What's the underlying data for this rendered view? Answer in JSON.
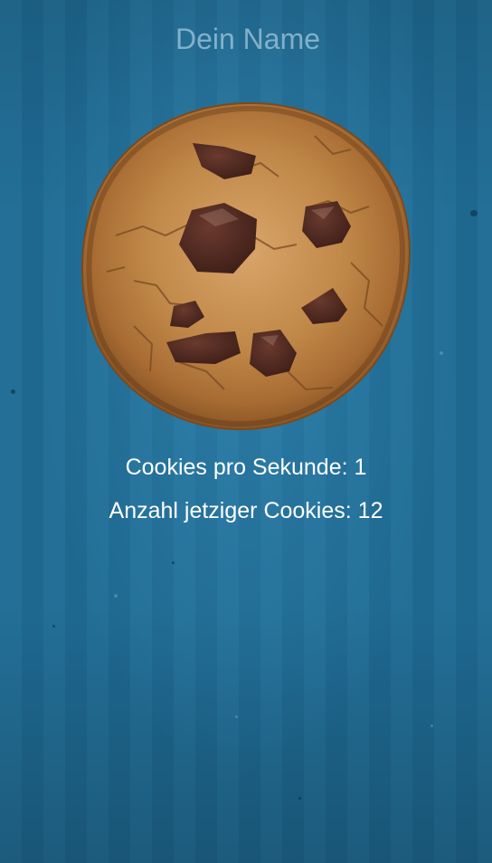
{
  "header": {
    "name_placeholder": "Dein Name",
    "name_value": ""
  },
  "cookie": {
    "icon": "cookie-icon"
  },
  "stats": {
    "cps_label": "Cookies pro Sekunde:",
    "cps_value": "1",
    "count_label": "Anzahl jetziger Cookies:",
    "count_value": "12"
  },
  "colors": {
    "background": "#1f6f96",
    "text": "#ffffff",
    "cookie_dough": "#b57b40",
    "chocolate": "#4a2820"
  }
}
